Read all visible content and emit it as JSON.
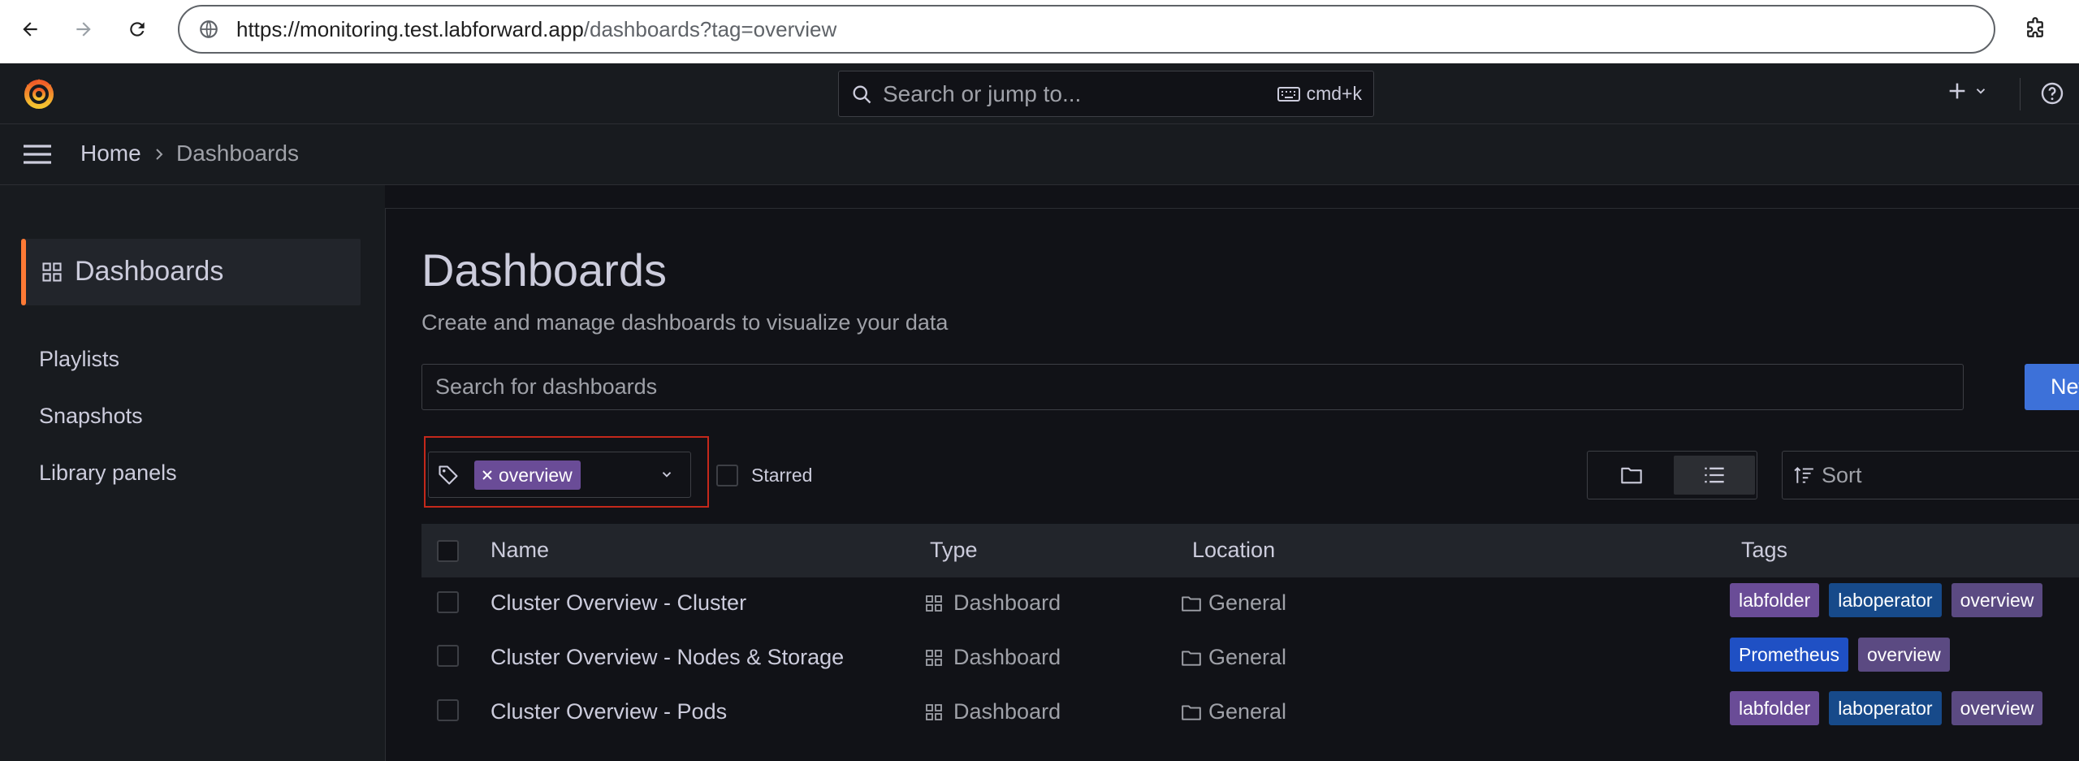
{
  "browser": {
    "url_host": "https://monitoring.test.labforward.app",
    "url_rest": "/dashboards?tag=overview"
  },
  "topbar": {
    "search_placeholder": "Search or jump to...",
    "search_shortcut": "cmd+k",
    "icons": [
      "grafana-logo-icon",
      "plus-icon",
      "chevron-down-icon",
      "help-icon"
    ]
  },
  "breadcrumb": {
    "home": "Home",
    "current": "Dashboards"
  },
  "sidebar": {
    "active": "Dashboards",
    "items": [
      "Playlists",
      "Snapshots",
      "Library panels"
    ]
  },
  "page": {
    "title": "Dashboards",
    "subtitle": "Create and manage dashboards to visualize your data",
    "search_placeholder": "Search for dashboards",
    "new_button": "New"
  },
  "filters": {
    "tag_chip": "overview",
    "starred_label": "Starred",
    "sort_placeholder": "Sort"
  },
  "table": {
    "columns": [
      "Name",
      "Type",
      "Location",
      "Tags"
    ],
    "rows": [
      {
        "name": "Cluster Overview - Cluster",
        "type": "Dashboard",
        "location": "General",
        "tags": [
          {
            "label": "labfolder",
            "color": "#6a4c97"
          },
          {
            "label": "laboperator",
            "color": "#174a8a"
          },
          {
            "label": "overview",
            "color": "#5b4a82"
          }
        ]
      },
      {
        "name": "Cluster Overview - Nodes & Storage",
        "type": "Dashboard",
        "location": "General",
        "tags": [
          {
            "label": "Prometheus",
            "color": "#1f50c4"
          },
          {
            "label": "overview",
            "color": "#5b4a82"
          }
        ]
      },
      {
        "name": "Cluster Overview - Pods",
        "type": "Dashboard",
        "location": "General",
        "tags": [
          {
            "label": "labfolder",
            "color": "#6a4c97"
          },
          {
            "label": "laboperator",
            "color": "#174a8a"
          },
          {
            "label": "overview",
            "color": "#5b4a82"
          }
        ]
      }
    ]
  },
  "colors": {
    "accent": "#ff7a35",
    "primary_button": "#3d71d9",
    "highlight_border": "#c4281b"
  }
}
